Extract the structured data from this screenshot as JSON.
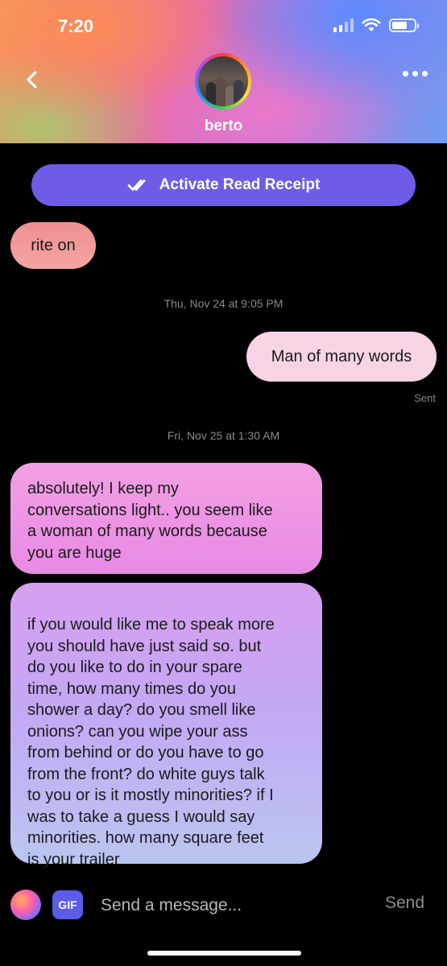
{
  "status_bar": {
    "time": "7:20",
    "battery_level": 0.7
  },
  "header": {
    "contact_name": "berto",
    "back_icon": "chevron-left-icon",
    "more_icon": "ellipsis-icon",
    "avatar": "contact-avatar"
  },
  "receipt_button": {
    "label": "Activate Read Receipt",
    "icon": "double-check-icon"
  },
  "messages": [
    {
      "side": "received",
      "text": "rite on"
    },
    {
      "timestamp": "Thu, Nov 24 at 9:05 PM"
    },
    {
      "side": "sent",
      "text": "Man of many words",
      "status": "Sent"
    },
    {
      "timestamp": "Fri, Nov 25 at 1:30 AM"
    },
    {
      "side": "received",
      "lines": [
        "absolutely! I keep my",
        "conversations light.. you seem like",
        "a woman of many words because",
        "you are huge"
      ]
    },
    {
      "side": "received",
      "lines": [
        "if you would like me to speak more",
        "you should have just said so. but",
        "do you like to do in your spare",
        "time, how many times do you",
        "shower a day? do you smell like",
        "onions? can you wipe your ass",
        "from behind or do you have to go",
        "from the front? do white guys talk",
        "to you or is it mostly minorities? if I",
        "was to take a guess I would say",
        "minorities. how many square feet",
        "is your trailer"
      ]
    }
  ],
  "composer": {
    "gif_label": "GIF",
    "placeholder": "Send a message...",
    "send_label": "Send"
  },
  "colors": {
    "accent": "#6e5ce6",
    "sent_bubble": "#f7d3e6",
    "received_bubble_pink": "#ee8f92"
  }
}
